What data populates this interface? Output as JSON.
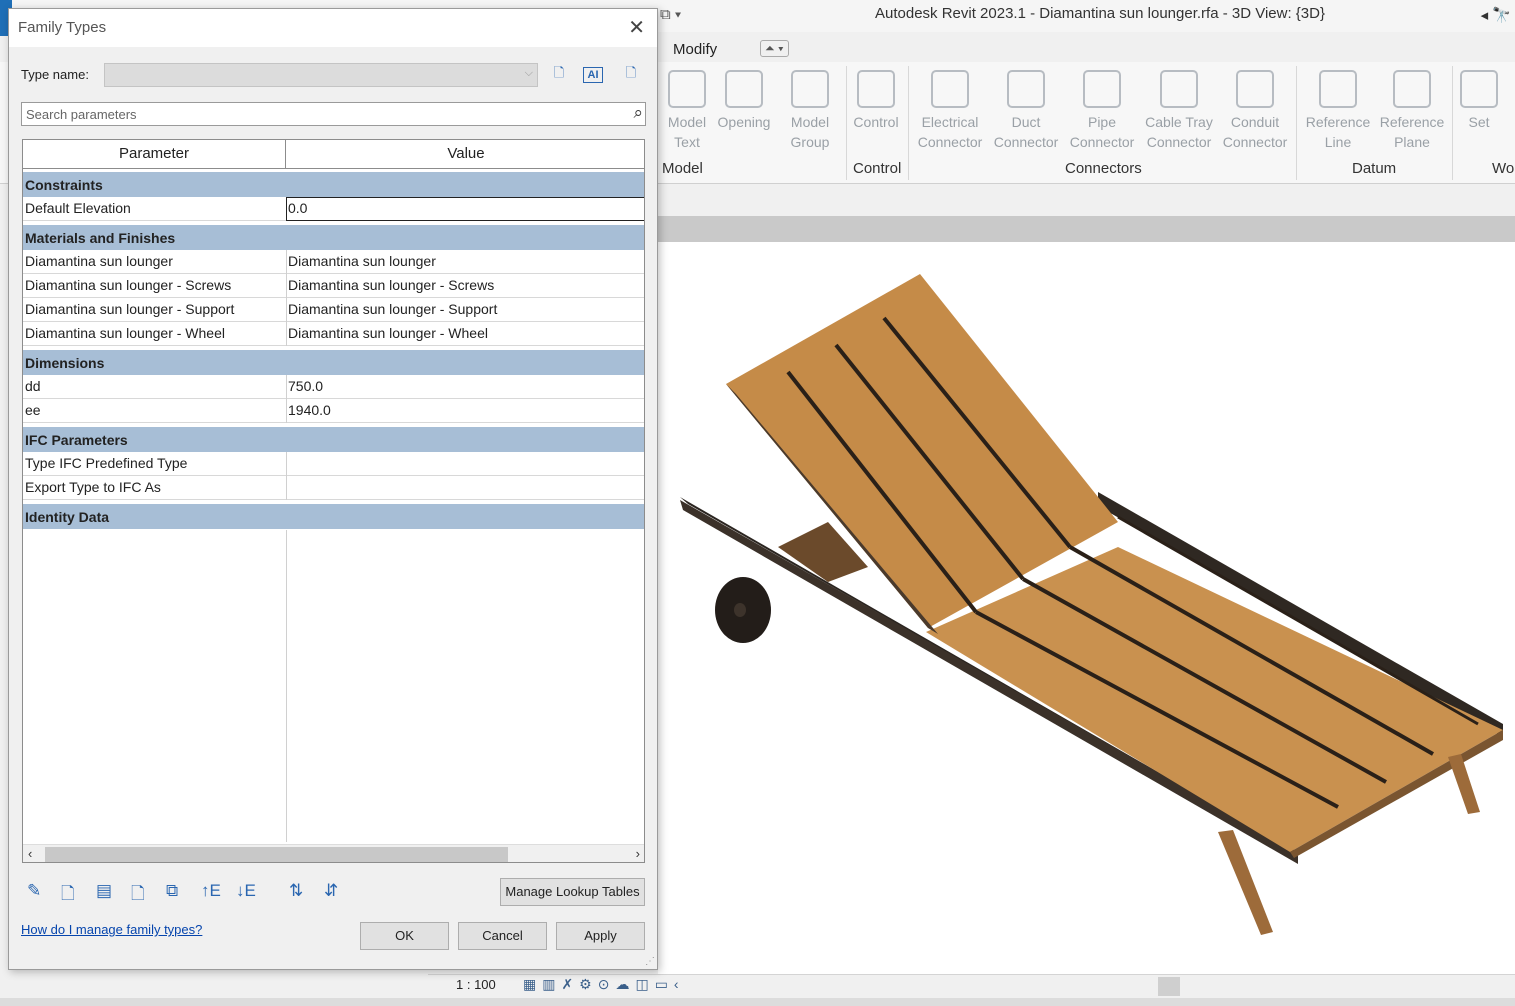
{
  "app": {
    "title": "Autodesk Revit 2023.1 - Diamantina sun lounger.rfa - 3D View: {3D}"
  },
  "ribbon": {
    "tab_modify": "Modify",
    "buttons": [
      {
        "label": "Model\nText"
      },
      {
        "label": "Opening"
      },
      {
        "label": "Model\nGroup"
      },
      {
        "label": "Control"
      },
      {
        "label": "Electrical\nConnector"
      },
      {
        "label": "Duct\nConnector"
      },
      {
        "label": "Pipe\nConnector"
      },
      {
        "label": "Cable Tray\nConnector"
      },
      {
        "label": "Conduit\nConnector"
      },
      {
        "label": "Reference\nLine"
      },
      {
        "label": "Reference\nPlane"
      },
      {
        "label": "Set"
      }
    ],
    "panels": [
      "Model",
      "Control",
      "Connectors",
      "Datum",
      "Wo"
    ]
  },
  "dialog": {
    "title": "Family Types",
    "type_name_label": "Type name:",
    "search_placeholder": "Search parameters",
    "columns": {
      "parameter": "Parameter",
      "value": "Value"
    },
    "groups": [
      {
        "name": "Constraints",
        "rows": [
          {
            "param": "Default Elevation",
            "value": "0.0"
          }
        ]
      },
      {
        "name": "Materials and Finishes",
        "rows": [
          {
            "param": "Diamantina sun lounger",
            "value": "Diamantina sun lounger"
          },
          {
            "param": "Diamantina sun lounger - Screws",
            "value": "Diamantina sun lounger - Screws"
          },
          {
            "param": "Diamantina sun lounger - Support",
            "value": "Diamantina sun lounger - Support"
          },
          {
            "param": "Diamantina sun lounger - Wheel",
            "value": "Diamantina sun lounger - Wheel"
          }
        ]
      },
      {
        "name": "Dimensions",
        "rows": [
          {
            "param": "dd",
            "value": "750.0"
          },
          {
            "param": "ee",
            "value": "1940.0"
          }
        ]
      },
      {
        "name": "IFC Parameters",
        "rows": [
          {
            "param": "Type IFC Predefined Type",
            "value": ""
          },
          {
            "param": "Export Type to IFC As",
            "value": ""
          }
        ]
      },
      {
        "name": "Identity Data",
        "rows": []
      }
    ],
    "manage_lookup": "Manage Lookup Tables",
    "help_link": "How do I manage family types?",
    "ok": "OK",
    "cancel": "Cancel",
    "apply": "Apply"
  },
  "status": {
    "scale": "1 : 100"
  }
}
